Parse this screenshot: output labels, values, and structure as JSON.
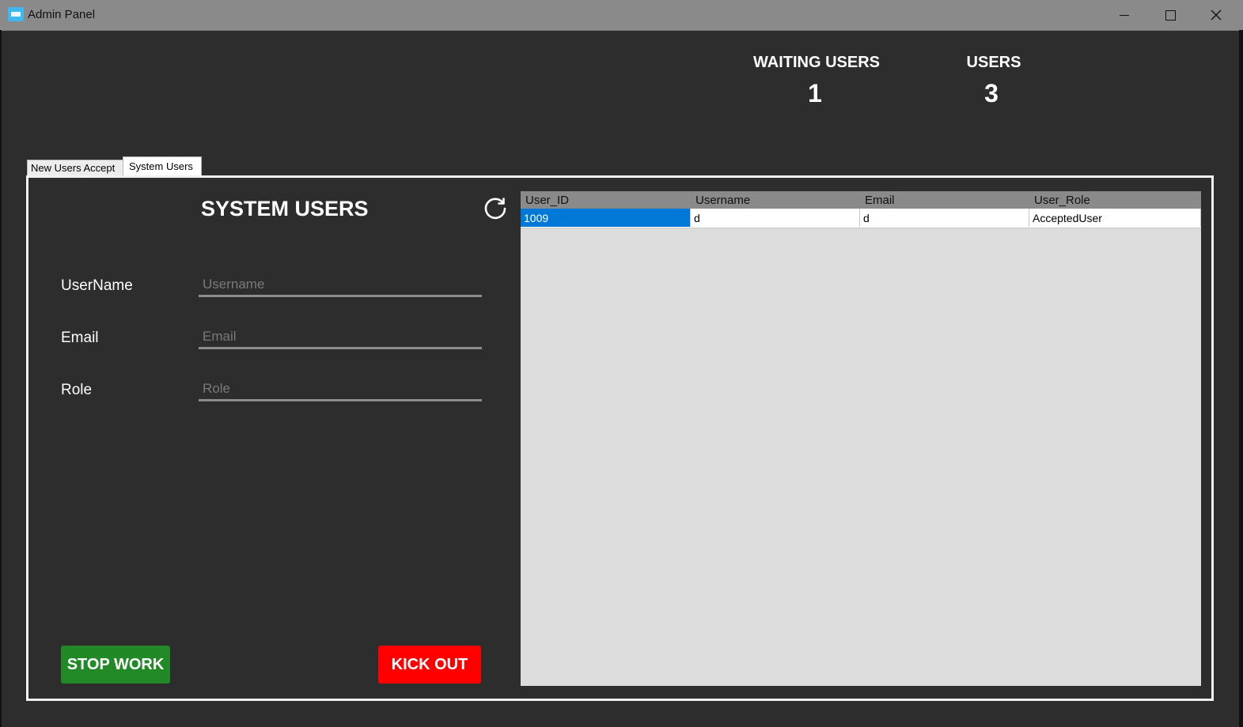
{
  "window": {
    "title": "Admin Panel",
    "icon": "app-window-icon",
    "controls": [
      "minimize-icon",
      "maximize-icon",
      "close-icon"
    ]
  },
  "stats": {
    "waiting_users_label": "WAITING USERS",
    "waiting_users_value": "1",
    "users_label": "USERS",
    "users_value": "3"
  },
  "tabs": [
    {
      "label": "New Users Accept",
      "active": false
    },
    {
      "label": "System Users",
      "active": true
    }
  ],
  "system_users": {
    "title": "SYSTEM USERS",
    "refresh_icon": "refresh-icon",
    "fields": {
      "username": {
        "label": "UserName",
        "placeholder": "Username",
        "value": ""
      },
      "email": {
        "label": "Email",
        "placeholder": "Email",
        "value": ""
      },
      "role": {
        "label": "Role",
        "placeholder": "Role",
        "value": ""
      }
    },
    "buttons": {
      "stop_work": "STOP WORK",
      "kick_out": "KICK OUT"
    }
  },
  "grid": {
    "columns": [
      "User_ID",
      "Username",
      "Email",
      "User_Role"
    ],
    "rows": [
      [
        "1009",
        "d",
        "d",
        "AcceptedUser"
      ]
    ]
  },
  "colors": {
    "background": "#2d2d2d",
    "stop_button": "#218a26",
    "kick_button": "#ff0000",
    "selection": "#0078d7"
  }
}
